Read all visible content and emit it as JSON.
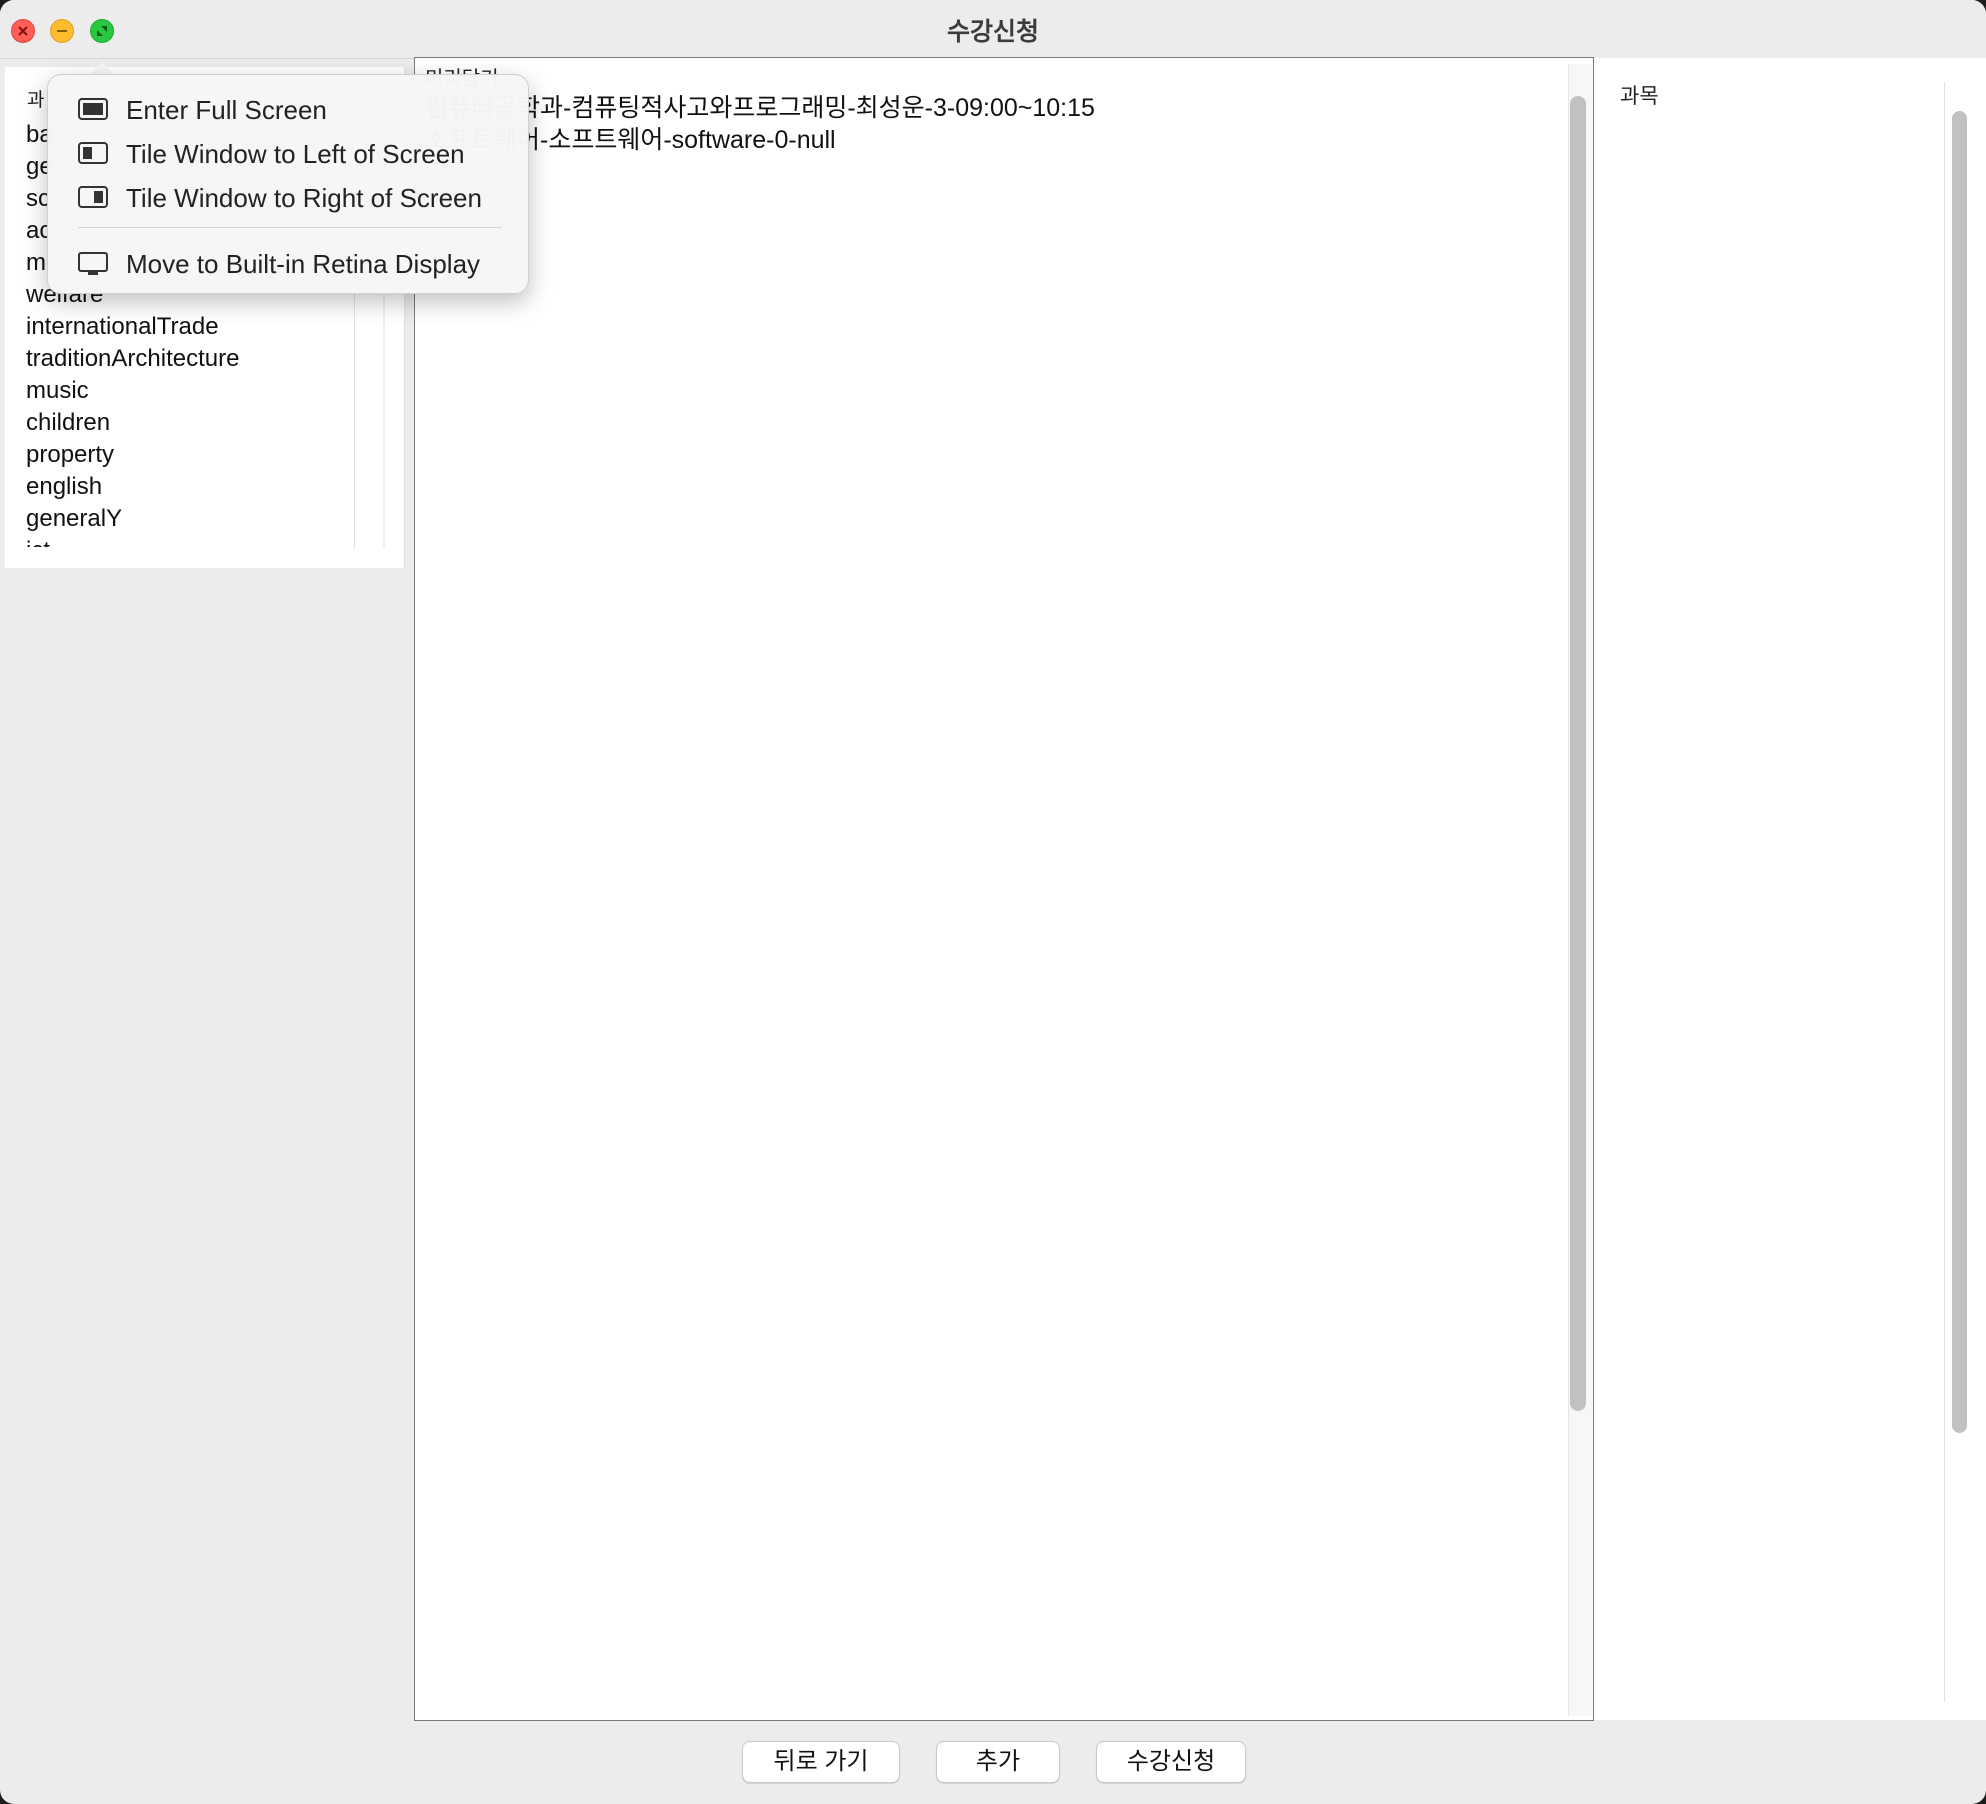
{
  "window": {
    "title": "수강신청"
  },
  "left_panel": {
    "header": "과",
    "items": [
      "ba",
      "ge",
      "sc",
      "ac",
      "m",
      "welfare",
      "internationalTrade",
      "traditionArchitecture",
      "music",
      "children",
      "property",
      "english",
      "generalY",
      "ict"
    ]
  },
  "center_panel": {
    "legend": "미리담기",
    "lines": [
      "컴퓨터공학과-컴퓨팅적사고와프로그래밍-최성운-3-09:00~10:15",
      "소프트웨어-소프트웨어-software-0-null"
    ]
  },
  "right_panel": {
    "header": "과목"
  },
  "buttons": {
    "back": "뒤로 가기",
    "add": "추가",
    "register": "수강신청"
  },
  "window_menu": {
    "items": [
      {
        "label": "Enter Full Screen",
        "icon": "full-screen-icon"
      },
      {
        "label": "Tile Window to Left of Screen",
        "icon": "tile-left-icon"
      },
      {
        "label": "Tile Window to Right of Screen",
        "icon": "tile-right-icon"
      },
      {
        "label": "Move to Built-in Retina Display",
        "icon": "display-icon"
      }
    ]
  },
  "colors": {
    "close": "#ff5f57",
    "minimize": "#febc2e",
    "maximize": "#28c840"
  }
}
